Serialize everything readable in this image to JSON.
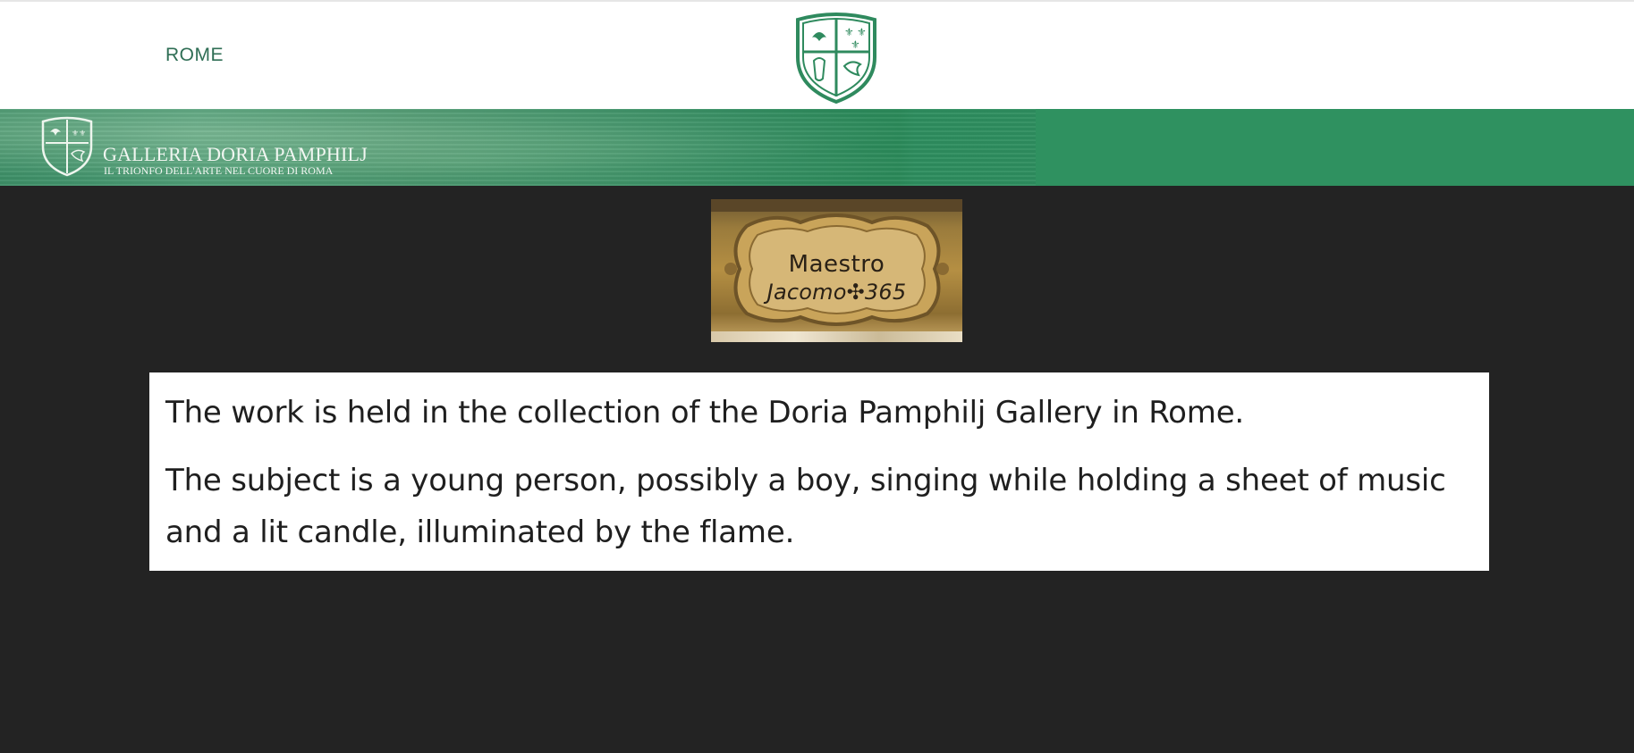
{
  "header": {
    "nav_label": "ROME",
    "logo_icon": "crest-icon"
  },
  "banner": {
    "title": "GALLERIA DORIA PAMPHILJ",
    "subtitle": "IL TRIONFO DELL'ARTE NEL CUORE DI ROMA",
    "logo_icon": "crest-icon",
    "accent_color": "#2f9160"
  },
  "plaque": {
    "line1": "Maestro",
    "line2": "Jacomo✣365"
  },
  "content": {
    "paragraph1": "The work is held in the collection of the Doria Pamphilj Gallery in Rome.",
    "paragraph2": "The subject is a young person, possibly a boy, singing while holding a sheet of music and a lit candle, illuminated by the flame."
  },
  "colors": {
    "brand_green": "#2f6e55",
    "page_background": "#232323"
  }
}
